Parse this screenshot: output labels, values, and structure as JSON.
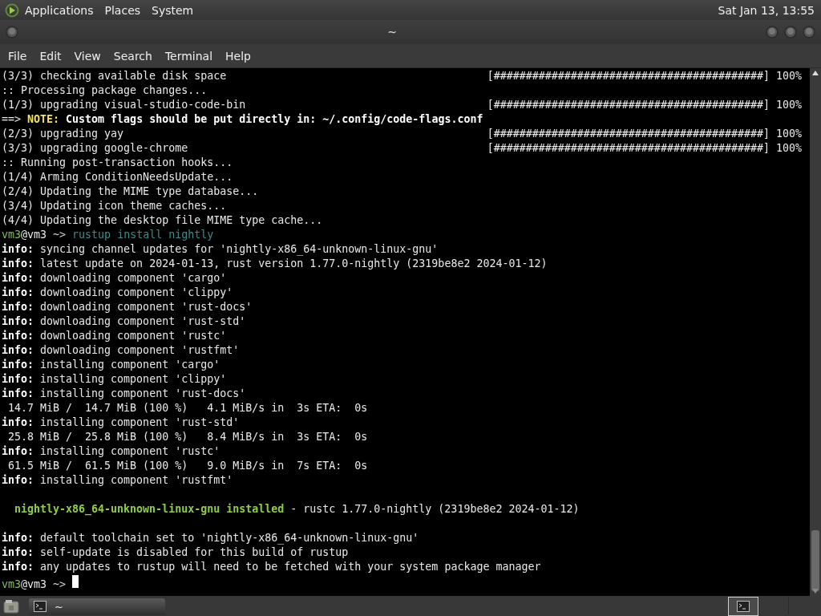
{
  "top_panel": {
    "menus": [
      "Applications",
      "Places",
      "System"
    ],
    "clock": "Sat Jan 13, 13:55"
  },
  "window": {
    "title": "~"
  },
  "menu_bar": [
    "File",
    "Edit",
    "View",
    "Search",
    "Terminal",
    "Help"
  ],
  "terminal": {
    "lines": [
      {
        "segments": [
          {
            "kind": "plain",
            "text": "(3/3) checking available disk space"
          }
        ],
        "progress": "[##########################################] 100%"
      },
      {
        "segments": [
          {
            "kind": "plain",
            "text": ":: Processing package changes..."
          }
        ]
      },
      {
        "segments": [
          {
            "kind": "plain",
            "text": "(1/3) upgrading visual-studio-code-bin"
          }
        ],
        "progress": "[##########################################] 100%"
      },
      {
        "segments": [
          {
            "kind": "plain",
            "text": "==> "
          },
          {
            "kind": "note",
            "text": "NOTE:"
          },
          {
            "kind": "bold",
            "text": " Custom flags should be put directly in: ~/.config/code-flags.conf"
          }
        ]
      },
      {
        "segments": [
          {
            "kind": "plain",
            "text": "(2/3) upgrading yay"
          }
        ],
        "progress": "[##########################################] 100%"
      },
      {
        "segments": [
          {
            "kind": "plain",
            "text": "(3/3) upgrading google-chrome"
          }
        ],
        "progress": "[##########################################] 100%"
      },
      {
        "segments": [
          {
            "kind": "plain",
            "text": ":: Running post-transaction hooks..."
          }
        ]
      },
      {
        "segments": [
          {
            "kind": "plain",
            "text": "(1/4) Arming ConditionNeedsUpdate..."
          }
        ]
      },
      {
        "segments": [
          {
            "kind": "plain",
            "text": "(2/4) Updating the MIME type database..."
          }
        ]
      },
      {
        "segments": [
          {
            "kind": "plain",
            "text": "(3/4) Updating icon theme caches..."
          }
        ]
      },
      {
        "segments": [
          {
            "kind": "plain",
            "text": "(4/4) Updating the desktop file MIME type cache..."
          }
        ]
      },
      {
        "segments": [
          {
            "kind": "user",
            "text": "vm3"
          },
          {
            "kind": "plain",
            "text": "@vm3"
          },
          {
            "kind": "dim",
            "text": " ~> "
          },
          {
            "kind": "command",
            "text": "rustup install nightly"
          }
        ]
      },
      {
        "segments": [
          {
            "kind": "bold",
            "text": "info:"
          },
          {
            "kind": "plain",
            "text": " syncing channel updates for 'nightly-x86_64-unknown-linux-gnu'"
          }
        ]
      },
      {
        "segments": [
          {
            "kind": "bold",
            "text": "info:"
          },
          {
            "kind": "plain",
            "text": " latest update on 2024-01-13, rust version 1.77.0-nightly (2319be8e2 2024-01-12)"
          }
        ]
      },
      {
        "segments": [
          {
            "kind": "bold",
            "text": "info:"
          },
          {
            "kind": "plain",
            "text": " downloading component 'cargo'"
          }
        ]
      },
      {
        "segments": [
          {
            "kind": "bold",
            "text": "info:"
          },
          {
            "kind": "plain",
            "text": " downloading component 'clippy'"
          }
        ]
      },
      {
        "segments": [
          {
            "kind": "bold",
            "text": "info:"
          },
          {
            "kind": "plain",
            "text": " downloading component 'rust-docs'"
          }
        ]
      },
      {
        "segments": [
          {
            "kind": "bold",
            "text": "info:"
          },
          {
            "kind": "plain",
            "text": " downloading component 'rust-std'"
          }
        ]
      },
      {
        "segments": [
          {
            "kind": "bold",
            "text": "info:"
          },
          {
            "kind": "plain",
            "text": " downloading component 'rustc'"
          }
        ]
      },
      {
        "segments": [
          {
            "kind": "bold",
            "text": "info:"
          },
          {
            "kind": "plain",
            "text": " downloading component 'rustfmt'"
          }
        ]
      },
      {
        "segments": [
          {
            "kind": "bold",
            "text": "info:"
          },
          {
            "kind": "plain",
            "text": " installing component 'cargo'"
          }
        ]
      },
      {
        "segments": [
          {
            "kind": "bold",
            "text": "info:"
          },
          {
            "kind": "plain",
            "text": " installing component 'clippy'"
          }
        ]
      },
      {
        "segments": [
          {
            "kind": "bold",
            "text": "info:"
          },
          {
            "kind": "plain",
            "text": " installing component 'rust-docs'"
          }
        ]
      },
      {
        "segments": [
          {
            "kind": "plain",
            "text": " 14.7 MiB /  14.7 MiB (100 %)   4.1 MiB/s in  3s ETA:  0s"
          }
        ]
      },
      {
        "segments": [
          {
            "kind": "bold",
            "text": "info:"
          },
          {
            "kind": "plain",
            "text": " installing component 'rust-std'"
          }
        ]
      },
      {
        "segments": [
          {
            "kind": "plain",
            "text": " 25.8 MiB /  25.8 MiB (100 %)   8.4 MiB/s in  3s ETA:  0s"
          }
        ]
      },
      {
        "segments": [
          {
            "kind": "bold",
            "text": "info:"
          },
          {
            "kind": "plain",
            "text": " installing component 'rustc'"
          }
        ]
      },
      {
        "segments": [
          {
            "kind": "plain",
            "text": " 61.5 MiB /  61.5 MiB (100 %)   9.0 MiB/s in  7s ETA:  0s"
          }
        ]
      },
      {
        "segments": [
          {
            "kind": "bold",
            "text": "info:"
          },
          {
            "kind": "plain",
            "text": " installing component 'rustfmt'"
          }
        ]
      },
      {
        "kind": "blank"
      },
      {
        "kind": "indented",
        "segments": [
          {
            "kind": "installed",
            "text": "nightly-x86_64-unknown-linux-gnu installed"
          },
          {
            "kind": "plain",
            "text": " - rustc 1.77.0-nightly (2319be8e2 2024-01-12)"
          }
        ]
      },
      {
        "kind": "blank"
      },
      {
        "segments": [
          {
            "kind": "bold",
            "text": "info:"
          },
          {
            "kind": "plain",
            "text": " default toolchain set to 'nightly-x86_64-unknown-linux-gnu'"
          }
        ]
      },
      {
        "segments": [
          {
            "kind": "bold",
            "text": "info:"
          },
          {
            "kind": "plain",
            "text": " self-update is disabled for this build of rustup"
          }
        ]
      },
      {
        "segments": [
          {
            "kind": "bold",
            "text": "info:"
          },
          {
            "kind": "plain",
            "text": " any updates to rustup will need to be fetched with your system package manager"
          }
        ]
      },
      {
        "segments": [
          {
            "kind": "user",
            "text": "vm3"
          },
          {
            "kind": "plain",
            "text": "@vm3"
          },
          {
            "kind": "dim",
            "text": " ~> "
          }
        ],
        "cursor": true
      }
    ]
  },
  "taskbar": {
    "tasks": [
      {
        "label": "~",
        "selected": false
      }
    ]
  }
}
